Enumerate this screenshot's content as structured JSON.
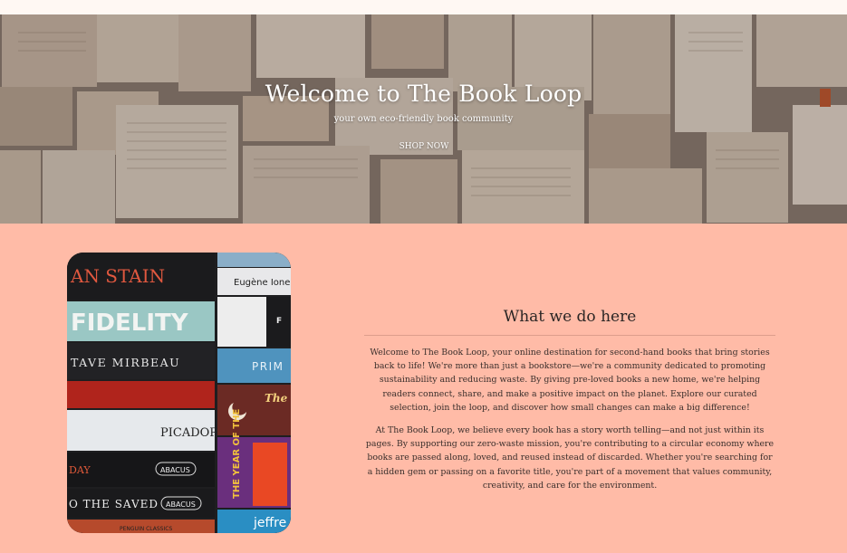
{
  "hero": {
    "title": "Welcome to The Book Loop",
    "subtitle": "your own eco-friendly book community",
    "button_label": "SHOP NOW"
  },
  "books": {
    "spines": [
      "AN STAIN",
      "FIDELITY",
      "TAVE MIRBEAU",
      "PICADOR",
      "DAY",
      "ABACUS",
      "O THE SAVED",
      "ABACUS",
      "PENGUIN CLASSICS",
      "Eugène Ione",
      "F",
      "PRIM",
      "The",
      "THE YEAR OF THE",
      "jeffre"
    ]
  },
  "about": {
    "title": "What we do here",
    "paragraph1": "Welcome to The Book Loop, your online destination for second-hand books that bring stories back to life! We're more than just a bookstore—we're a community dedicated to promoting sustainability and reducing waste. By giving pre-loved books a new home, we're helping readers connect, share, and make a positive impact on the planet. Explore our curated selection, join the loop, and discover how small changes can make a big difference!",
    "paragraph2": "At The Book Loop, we believe every book has a story worth telling—and not just within its pages. By supporting our zero-waste mission, you're contributing to a circular economy where books are passed along, loved, and reused instead of discarded. Whether you're searching for a hidden gem or passing on a favorite title, you're part of a movement that values community, creativity, and care for the environment."
  },
  "colors": {
    "page_background": "#ffbba7",
    "top_strip": "#fff8f3",
    "hero_text": "#ffffff"
  }
}
